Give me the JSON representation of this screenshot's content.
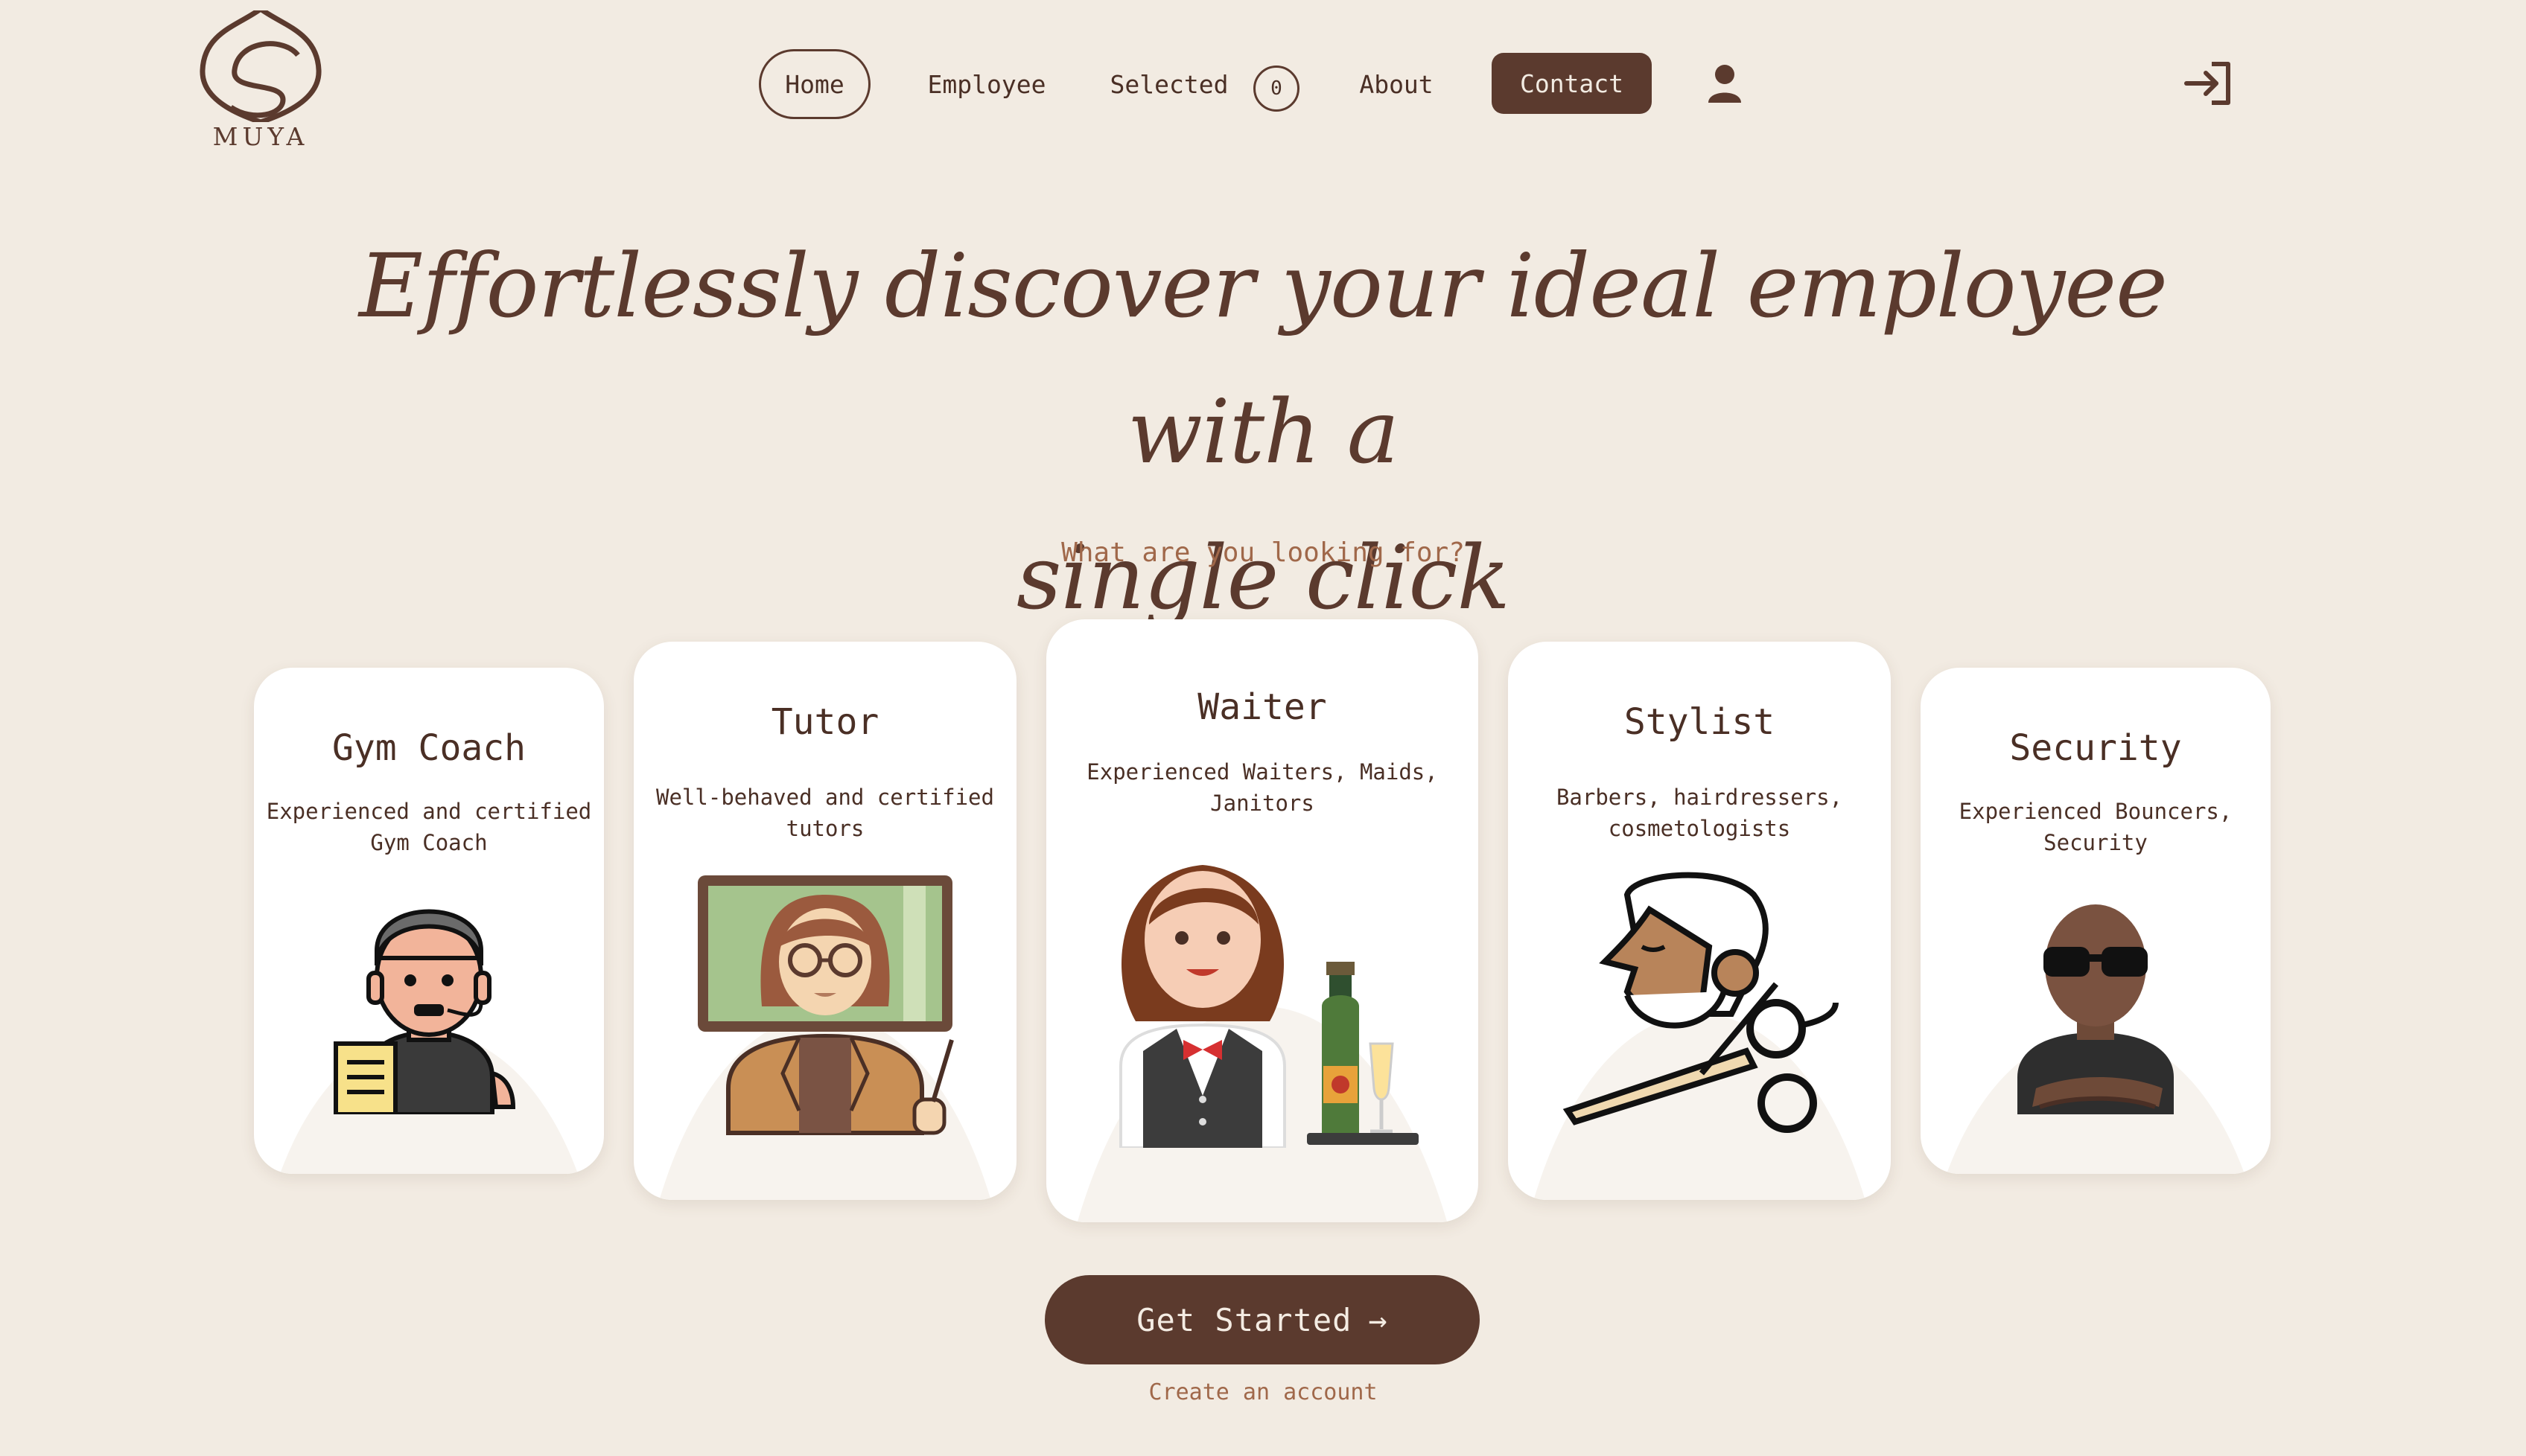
{
  "brand": {
    "logo_text": "MUYA"
  },
  "nav": {
    "home": "Home",
    "employee": "Employee",
    "selected": "Selected",
    "selected_count": "0",
    "about": "About",
    "contact": "Contact"
  },
  "hero": {
    "title_line1": "Effortlessly discover your ideal employee with a",
    "title_line2": "single click",
    "subtitle": "What are you looking for?"
  },
  "cards": [
    {
      "title": "Gym Coach",
      "desc": "Experienced and certified Gym Coach",
      "icon": "gym-coach-icon"
    },
    {
      "title": "Tutor",
      "desc": "Well-behaved and certified tutors",
      "icon": "tutor-icon"
    },
    {
      "title": "Waiter",
      "desc": "Experienced Waiters, Maids, Janitors",
      "icon": "waiter-icon"
    },
    {
      "title": "Stylist",
      "desc": "Barbers, hairdressers, cosmetologists",
      "icon": "stylist-icon"
    },
    {
      "title": "Security",
      "desc": "Experienced Bouncers, Security",
      "icon": "security-icon"
    }
  ],
  "cta": {
    "label": "Get Started",
    "arrow": "→",
    "secondary": "Create an account"
  },
  "colors": {
    "background": "#f2ebe2",
    "brand": "#5b3a2e",
    "accent_text": "#a0684a",
    "card": "#ffffff"
  }
}
